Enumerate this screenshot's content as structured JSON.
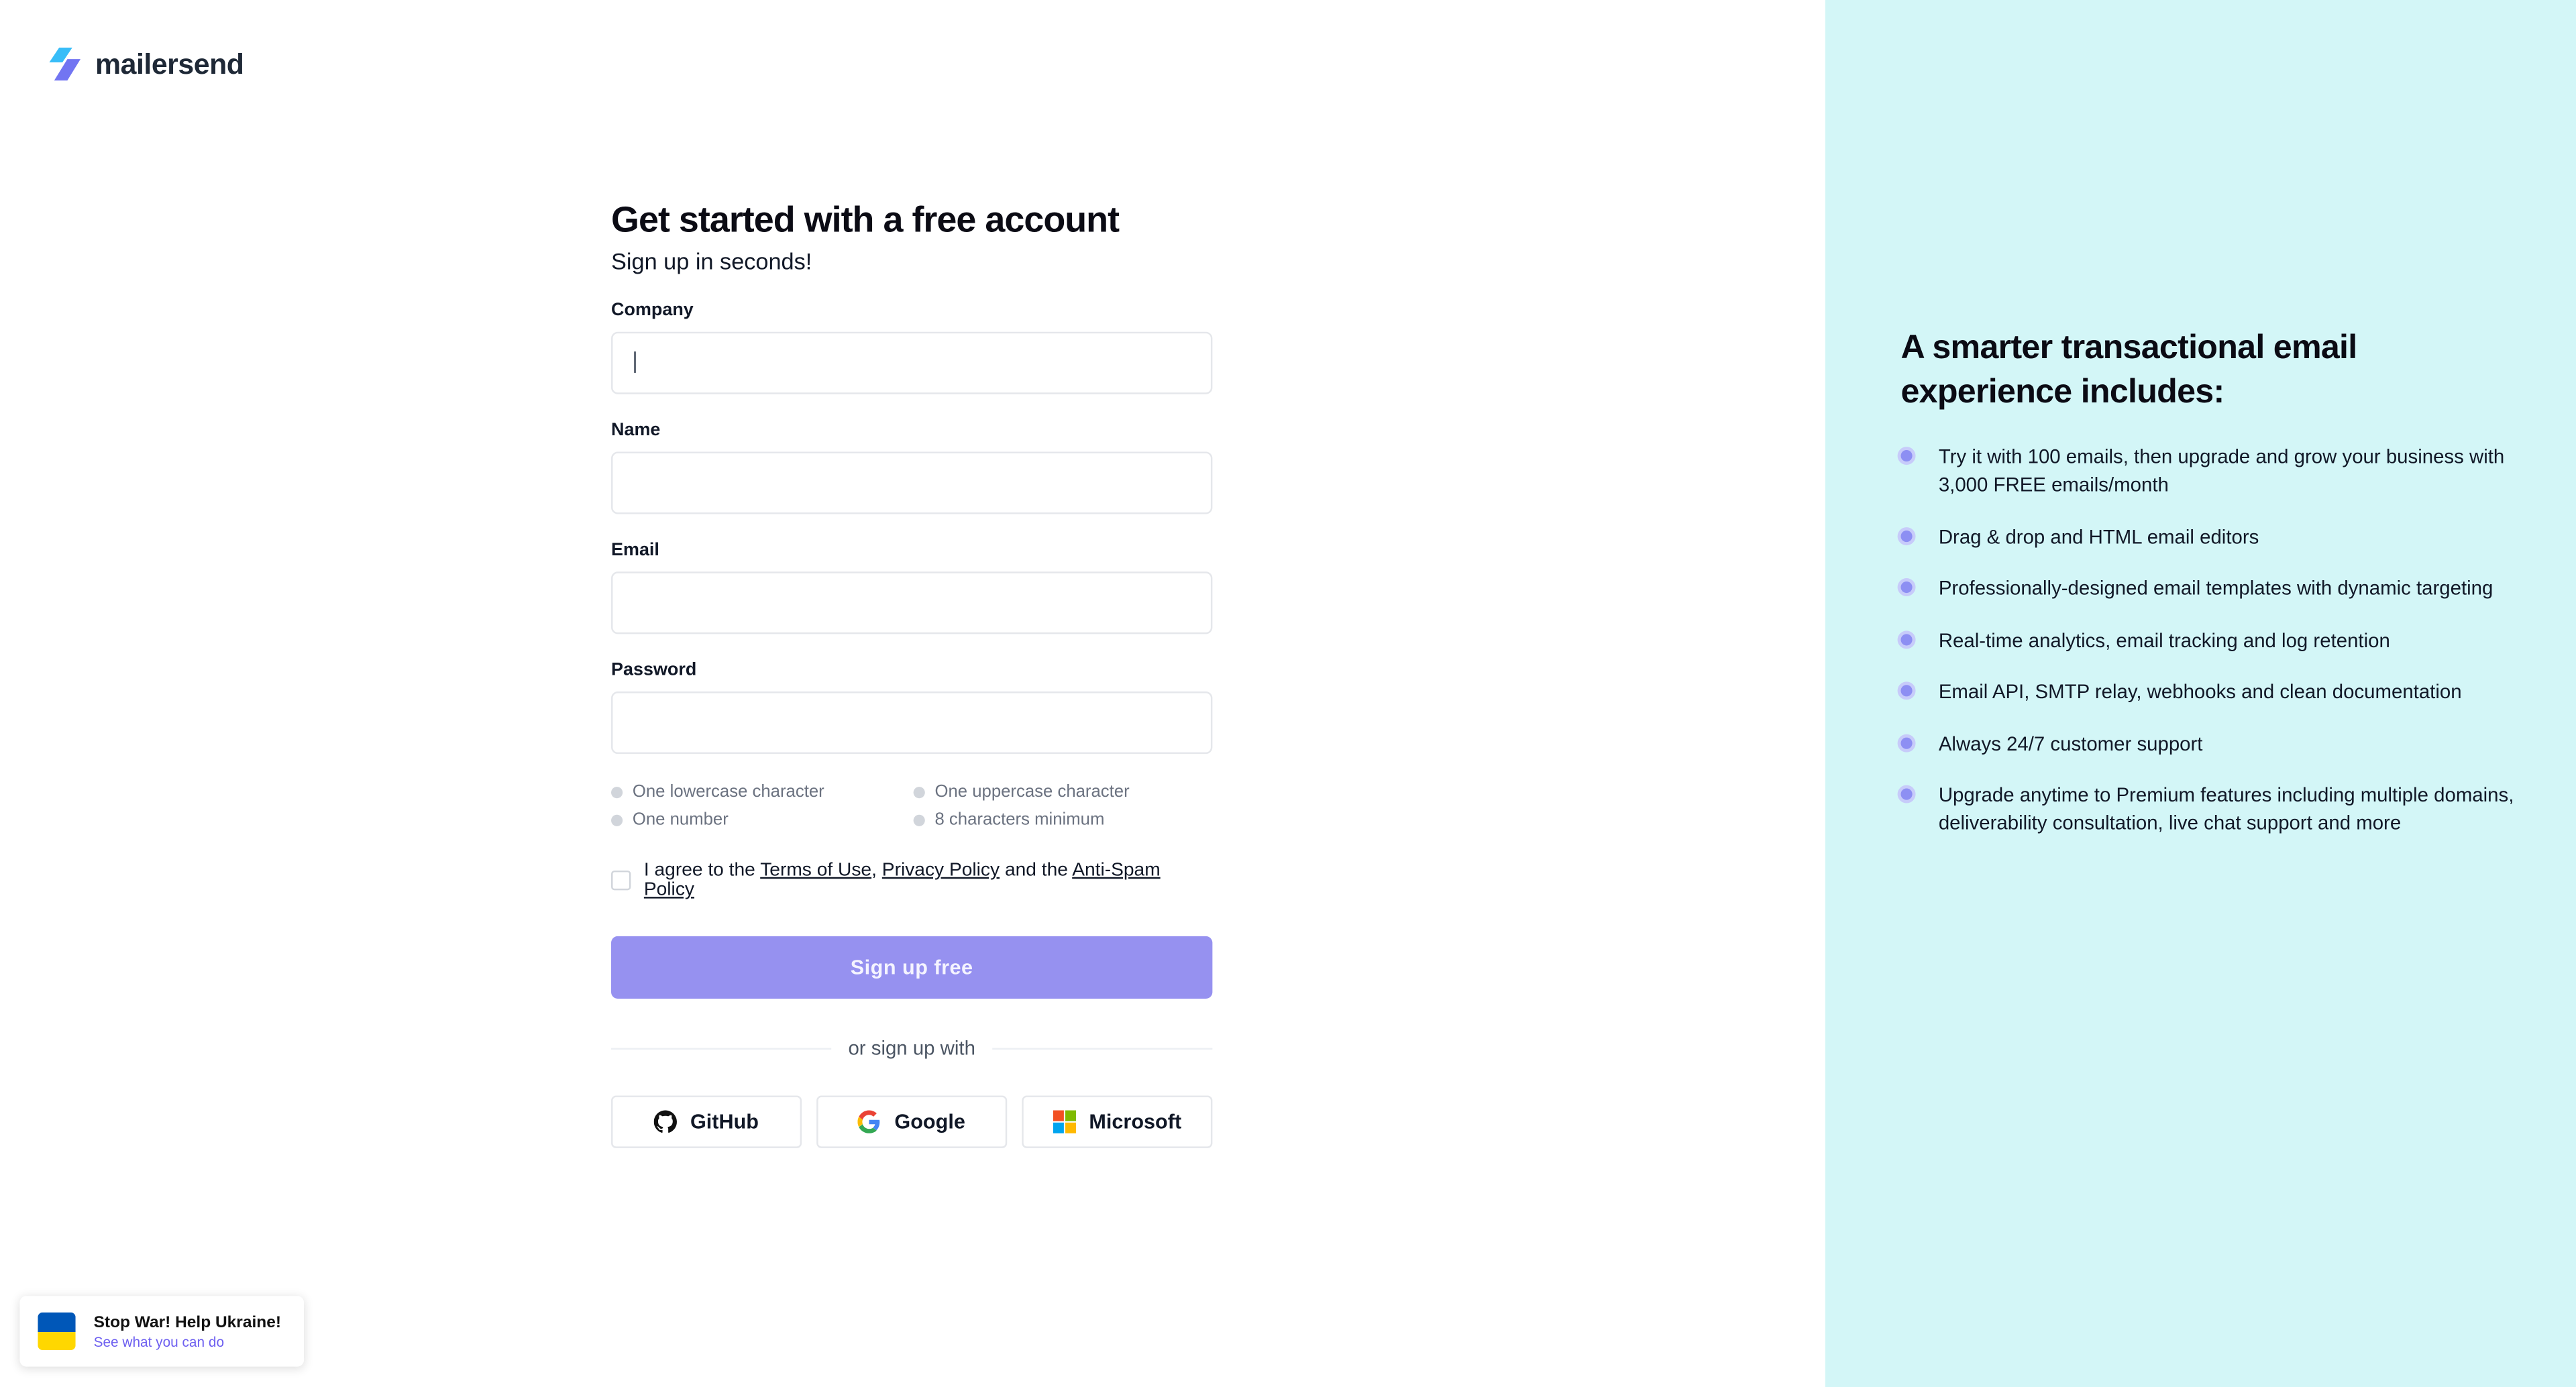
{
  "brand": {
    "name": "mailersend"
  },
  "signup": {
    "title": "Get started with a free account",
    "subtitle": "Sign up in seconds!",
    "fields": {
      "company": {
        "label": "Company",
        "value": "",
        "placeholder": ""
      },
      "name": {
        "label": "Name",
        "value": "",
        "placeholder": ""
      },
      "email": {
        "label": "Email",
        "value": "",
        "placeholder": ""
      },
      "password": {
        "label": "Password",
        "value": "",
        "placeholder": ""
      }
    },
    "password_rules": [
      "One lowercase character",
      "One uppercase character",
      "One number",
      "8 characters minimum"
    ],
    "agree": {
      "prefix": "I agree to the",
      "terms": "Terms of Use",
      "comma": ",",
      "privacy": "Privacy Policy",
      "and": "and the",
      "antispam": "Anti-Spam Policy"
    },
    "submit_label": "Sign up free",
    "divider_text": "or sign up with",
    "socials": {
      "github": "GitHub",
      "google": "Google",
      "microsoft": "Microsoft"
    }
  },
  "ukraine_banner": {
    "title": "Stop War! Help Ukraine!",
    "link": "See what you can do"
  },
  "benefits": {
    "heading": "A smarter transactional email experience includes:",
    "items": [
      "Try it with 100 emails, then upgrade and grow your business with 3,000 FREE emails/month",
      "Drag & drop and HTML email editors",
      "Professionally-designed email templates with dynamic targeting",
      "Real-time analytics, email tracking and log retention",
      "Email API, SMTP relay, webhooks and clean documentation",
      "Always 24/7 customer support",
      "Upgrade anytime to Premium features including multiple domains, deliverability consultation, live chat support and more"
    ]
  },
  "colors": {
    "accent": "#9691f0",
    "panel": "#d3f6f7",
    "bullet": "#8d8ff3"
  }
}
